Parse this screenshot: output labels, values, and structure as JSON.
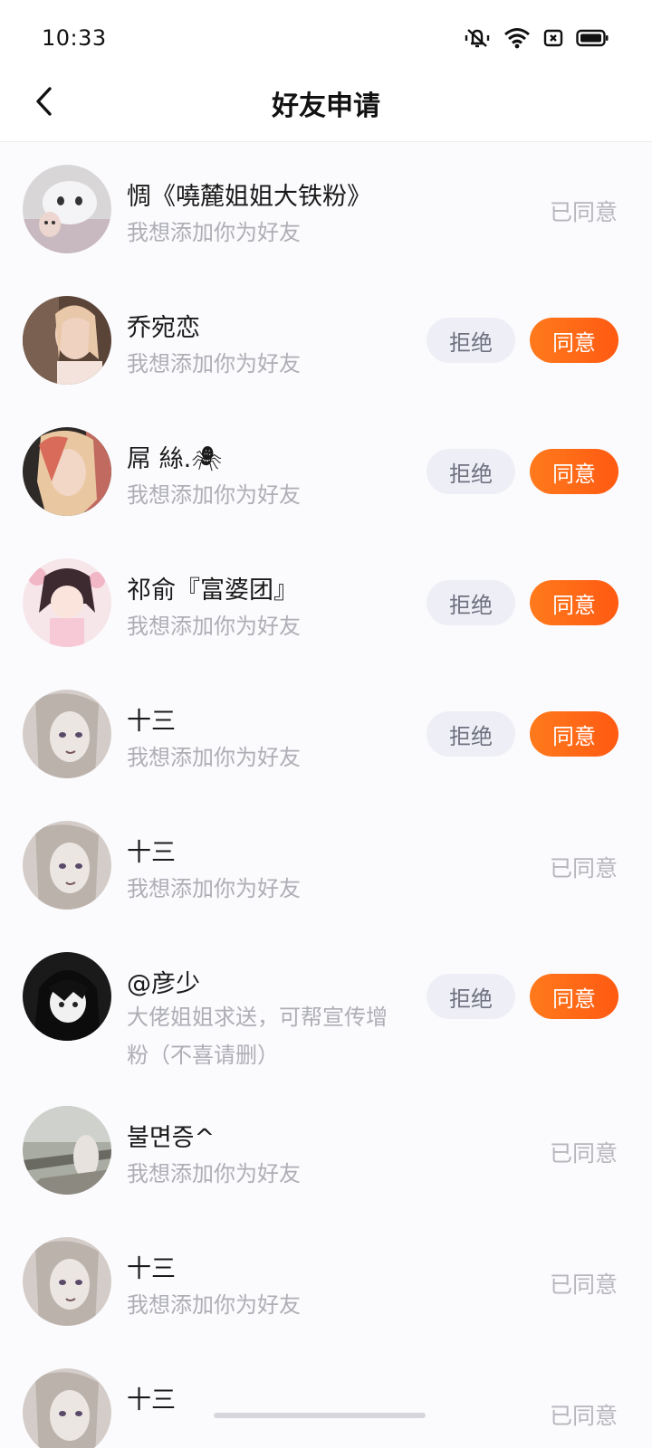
{
  "status": {
    "time": "10:33"
  },
  "header": {
    "title": "好友申请"
  },
  "actions": {
    "reject_label": "拒绝",
    "accept_label": "同意",
    "agreed_label": "已同意"
  },
  "requests": [
    {
      "name": "惆《嘵麓姐姐大铁粉》",
      "message": "我想添加你为好友",
      "status": "已同意"
    },
    {
      "name": "乔宛恋",
      "message": "我想添加你为好友",
      "status": "pending"
    },
    {
      "name": "屌  絲.🕷",
      "message": "我想添加你为好友",
      "status": "pending"
    },
    {
      "name": "祁俞『富婆团』",
      "message": "我想添加你为好友",
      "status": "pending"
    },
    {
      "name": "十三",
      "message": "我想添加你为好友",
      "status": "pending"
    },
    {
      "name": "十三",
      "message": "我想添加你为好友",
      "status": "已同意"
    },
    {
      "name": "@彦少",
      "message": "大佬姐姐求送，可帮宣传增粉（不喜请删）",
      "status": "pending"
    },
    {
      "name": "불면증^",
      "message": "我想添加你为好友",
      "status": "已同意"
    },
    {
      "name": "十三",
      "message": "我想添加你为好友",
      "status": "已同意"
    },
    {
      "name": "十三",
      "message": "",
      "status": "已同意"
    }
  ],
  "icons": {
    "back": "chevron-left-icon",
    "mute": "bell-off-icon",
    "wifi": "wifi-icon",
    "sim": "sim-card-icon",
    "battery": "battery-icon"
  }
}
